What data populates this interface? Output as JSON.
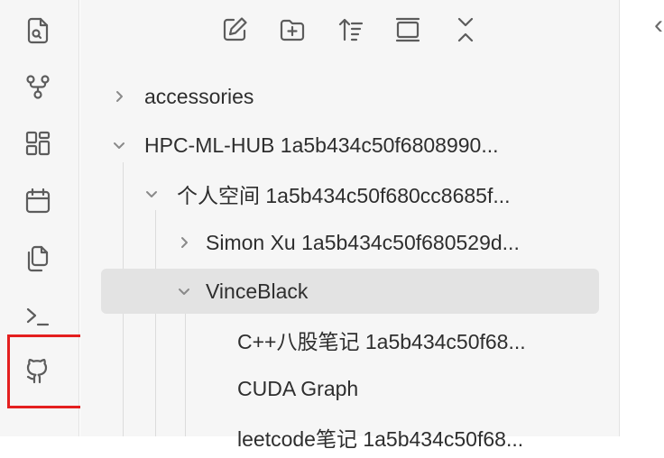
{
  "ribbon": {
    "icons": [
      {
        "name": "file-search-icon"
      },
      {
        "name": "graph-view-icon"
      },
      {
        "name": "canvas-icon"
      },
      {
        "name": "calendar-icon"
      },
      {
        "name": "copy-icon"
      },
      {
        "name": "terminal-icon"
      },
      {
        "name": "github-icon",
        "highlighted": true
      }
    ],
    "highlight_color": "#e41f1f"
  },
  "explorer": {
    "toolbar": [
      {
        "name": "new-note-icon"
      },
      {
        "name": "new-folder-icon"
      },
      {
        "name": "sort-icon"
      },
      {
        "name": "collapse-panel-icon"
      },
      {
        "name": "collapse-all-icon"
      }
    ],
    "tree": [
      {
        "label": "accessories",
        "expanded": false
      },
      {
        "label": "HPC-ML-HUB 1a5b434c50f6808990...",
        "expanded": true
      },
      {
        "label": "个人空间 1a5b434c50f680cc8685f...",
        "expanded": true
      },
      {
        "label": "Simon Xu 1a5b434c50f680529d...",
        "expanded": false
      },
      {
        "label": "VinceBlack",
        "expanded": true,
        "selected": true
      },
      {
        "label": "C++八股笔记 1a5b434c50f68..."
      },
      {
        "label": "CUDA Graph"
      },
      {
        "label": "leetcode笔记 1a5b434c50f68..."
      }
    ]
  },
  "editor": {
    "back_arrow": "‹"
  }
}
